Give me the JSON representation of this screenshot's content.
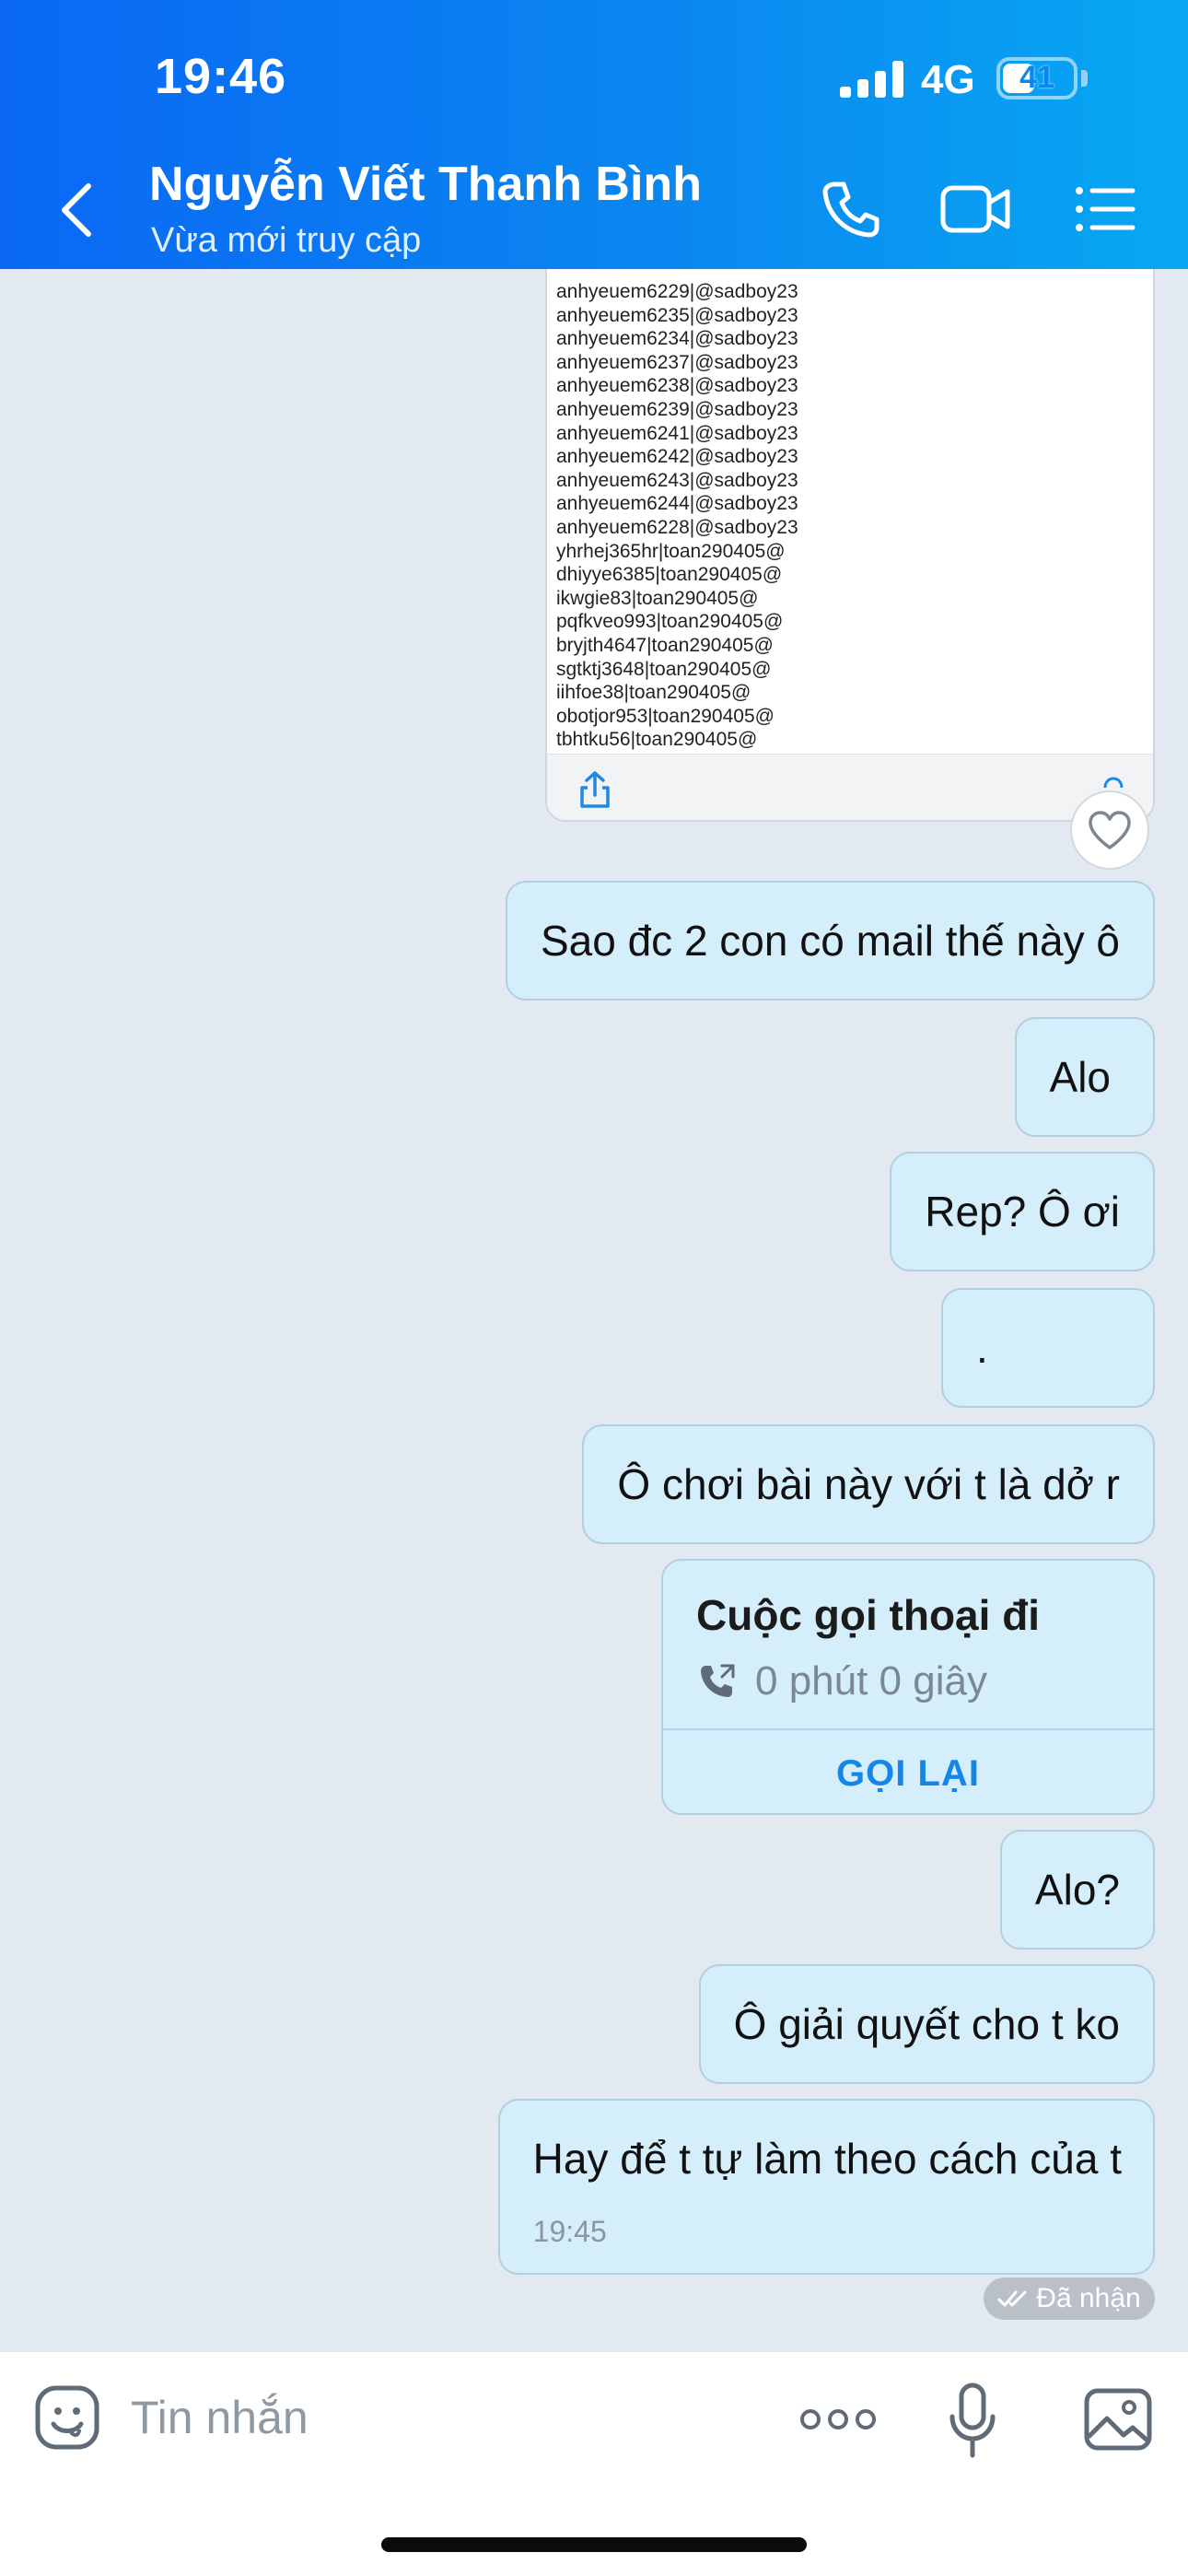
{
  "status_bar": {
    "time": "19:46",
    "network": "4G",
    "battery": "41"
  },
  "header": {
    "contact_name": "Nguyễn Viết Thanh Bình",
    "contact_status": "Vừa mới truy cập",
    "icons": [
      "back-icon",
      "phone-icon",
      "video-icon",
      "menu-icon"
    ]
  },
  "image_preview": {
    "lines": [
      "anhyeuem6229|@sadboy23",
      "anhyeuem6235|@sadboy23",
      "anhyeuem6234|@sadboy23",
      "anhyeuem6237|@sadboy23",
      "anhyeuem6238|@sadboy23",
      "anhyeuem6239|@sadboy23",
      "anhyeuem6241|@sadboy23",
      "anhyeuem6242|@sadboy23",
      "anhyeuem6243|@sadboy23",
      "anhyeuem6244|@sadboy23",
      "anhyeuem6228|@sadboy23",
      "yhrhej365hr|toan290405@",
      "dhiyye6385|toan290405@",
      "ikwgie83|toan290405@",
      "pqfkveo993|toan290405@",
      "bryjth4647|toan290405@",
      "sgtktj3648|toan290405@",
      "iihfoe38|toan290405@",
      "obotjor953|toan290405@",
      "tbhtku56|toan290405@"
    ]
  },
  "messages": [
    {
      "text": "Sao đc 2 con có mail thế này ô"
    },
    {
      "text": "Alo"
    },
    {
      "text": "Rep? Ô ơi"
    },
    {
      "text": "."
    },
    {
      "text": "Ô chơi bài này với t là dở r"
    },
    {
      "text": "Alo?"
    },
    {
      "text": "Ô giải quyết cho t ko"
    },
    {
      "text": "Hay để t tự làm theo cách của t",
      "time": "19:45"
    }
  ],
  "call_card": {
    "title": "Cuộc gọi thoại đi",
    "duration": "0 phút 0 giây",
    "action": "GỌI LẠI"
  },
  "read_receipt": "Đã nhận",
  "input_bar": {
    "placeholder": "Tin nhắn"
  },
  "colors": {
    "header_gradient_start": "#0a68f4",
    "header_gradient_end": "#08a8f2",
    "bubble_bg": "#d5eefc",
    "chat_bg": "#e2e9f1",
    "accent": "#1586e8"
  }
}
